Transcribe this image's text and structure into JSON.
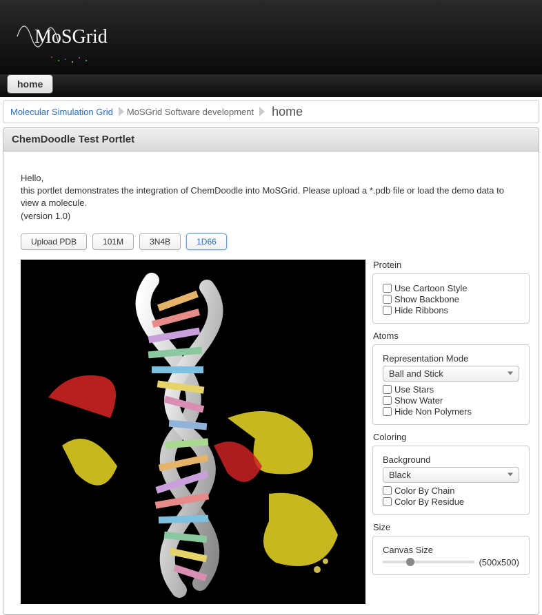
{
  "brand": "MoSGrid",
  "nav": {
    "home_tab": "home"
  },
  "breadcrumb": {
    "items": [
      {
        "label": "Molecular Simulation Grid",
        "link": true
      },
      {
        "label": "MoSGrid Software development",
        "link": false
      }
    ],
    "current": "home"
  },
  "portlet": {
    "title": "ChemDoodle Test Portlet",
    "intro_greeting": "Hello,",
    "intro_body": "this portlet demonstrates the integration of ChemDoodle into MoSGrid. Please upload a *.pdb file or load the demo data to view a molecule.",
    "intro_version": "(version 1.0)"
  },
  "buttons": {
    "upload": "Upload PDB",
    "m101": "101M",
    "n3b4": "3N4B",
    "d166": "1D66"
  },
  "controls": {
    "protein": {
      "title": "Protein",
      "cartoon": "Use Cartoon Style",
      "backbone": "Show Backbone",
      "hide_ribbons": "Hide Ribbons"
    },
    "atoms": {
      "title": "Atoms",
      "rep_label": "Representation Mode",
      "rep_value": "Ball and Stick",
      "stars": "Use Stars",
      "water": "Show Water",
      "hide_nonpoly": "Hide Non Polymers"
    },
    "coloring": {
      "title": "Coloring",
      "bg_label": "Background",
      "bg_value": "Black",
      "by_chain": "Color By Chain",
      "by_residue": "Color By Residue"
    },
    "size": {
      "title": "Size",
      "canvas_label": "Canvas Size",
      "value": "(500x500)"
    }
  }
}
